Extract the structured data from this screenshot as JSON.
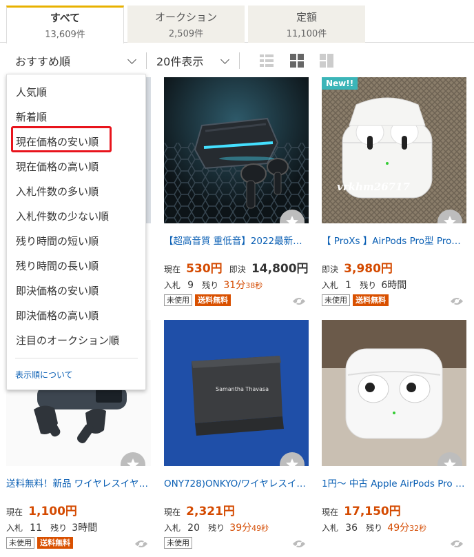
{
  "tabs": [
    {
      "label": "すべて",
      "count": "13,609件"
    },
    {
      "label": "オークション",
      "count": "2,509件"
    },
    {
      "label": "定額",
      "count": "11,100件"
    }
  ],
  "sort": {
    "selected": "おすすめ順",
    "per_page": "20件表示"
  },
  "dropdown": {
    "items": [
      "人気順",
      "新着順",
      "現在価格の安い順",
      "現在価格の高い順",
      "入札件数の多い順",
      "入札件数の少ない順",
      "残り時間の短い順",
      "残り時間の長い順",
      "即決価格の安い順",
      "即決価格の高い順",
      "注目のオークション順"
    ],
    "highlighted": "現在価格の安い順",
    "footer_link": "表示順について"
  },
  "products": [
    {
      "title": "【超高音質 重低音】2022最新…",
      "current_label": "現在",
      "current_price": "530円",
      "buyout_label": "即決",
      "buyout_price": "14,800円",
      "bids_label": "入札",
      "bids": "9",
      "remain_label": "残り",
      "remain_main": "31分",
      "remain_sub": "38秒",
      "condition": "未使用",
      "shipping": "送料無料"
    },
    {
      "badge": "New!!",
      "watermark": "vrkhm26717",
      "title": "【 ProXs 】AirPods Pro型 ProX…",
      "buyout_label": "即決",
      "buyout_price": "3,980円",
      "bids_label": "入札",
      "bids": "1",
      "remain_label": "残り",
      "remain_main": "6時間",
      "condition": "未使用",
      "shipping": "送料無料"
    },
    {
      "title": "送料無料！新品 ワイヤレスイヤ…",
      "current_label": "現在",
      "current_price": "1,100円",
      "bids_label": "入札",
      "bids": "11",
      "remain_label": "残り",
      "remain_main": "3時間",
      "condition": "未使用",
      "shipping": "送料無料"
    },
    {
      "box_text": "Samantha Thavasa",
      "title": "ONY728)ONKYO/ワイヤレスイ…",
      "current_label": "現在",
      "current_price": "2,321円",
      "bids_label": "入札",
      "bids": "20",
      "remain_label": "残り",
      "remain_main": "39分",
      "remain_sub": "49秒",
      "condition": "未使用"
    },
    {
      "title": "1円～ 中古 Apple AirPods Pro …",
      "current_label": "現在",
      "current_price": "17,150円",
      "bids_label": "入札",
      "bids": "36",
      "remain_label": "残り",
      "remain_main": "49分",
      "remain_sub": "32秒"
    }
  ]
}
